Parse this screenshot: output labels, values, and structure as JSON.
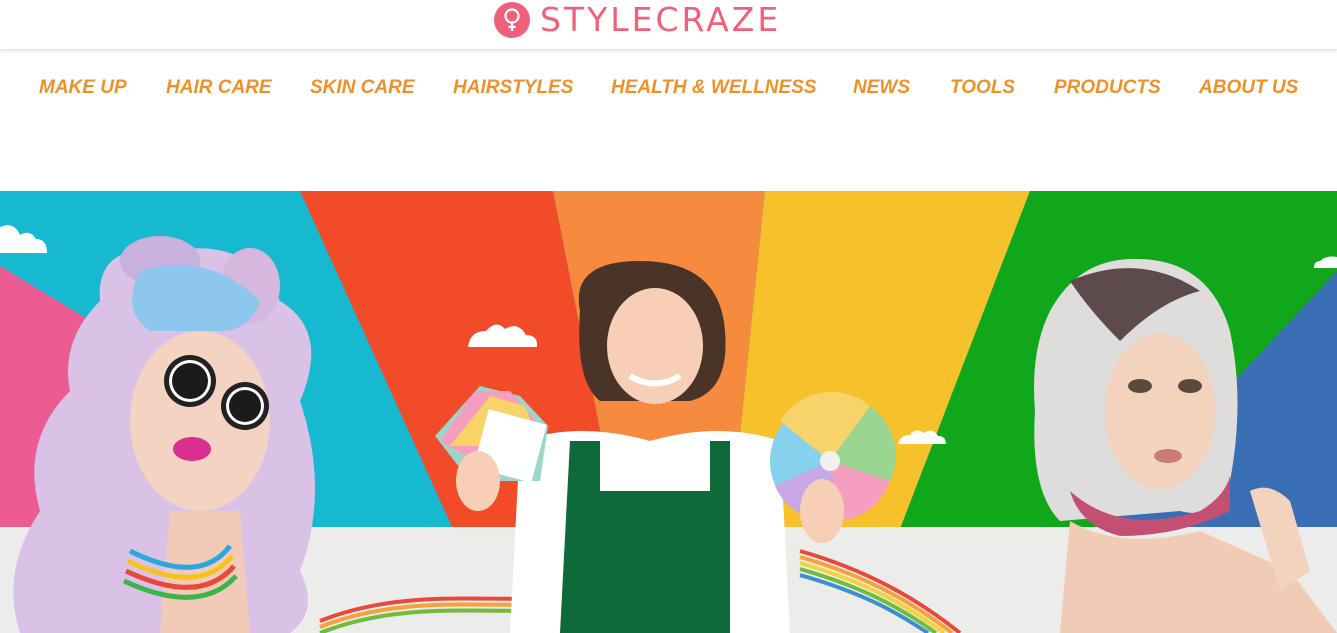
{
  "brand": {
    "name": "STYLECRAZE",
    "color": "#f0607b"
  },
  "nav": {
    "color": "#ef9128",
    "items": [
      {
        "label": "MAKE UP"
      },
      {
        "label": "HAIR CARE"
      },
      {
        "label": "SKIN CARE"
      },
      {
        "label": "HAIRSTYLES"
      },
      {
        "label": "HEALTH & WELLNESS"
      },
      {
        "label": "NEWS"
      },
      {
        "label": "TOOLS"
      },
      {
        "label": "PRODUCTS"
      },
      {
        "label": "ABOUT US"
      }
    ]
  },
  "hero": {
    "colors": {
      "cyan": "#16b9cf",
      "red": "#f24b2a",
      "orange": "#f68b3f",
      "yellow": "#f6c12a",
      "green": "#10a81a",
      "blue": "#3a6fb5",
      "pink": "#ec5c93",
      "floor": "#ececea"
    }
  }
}
